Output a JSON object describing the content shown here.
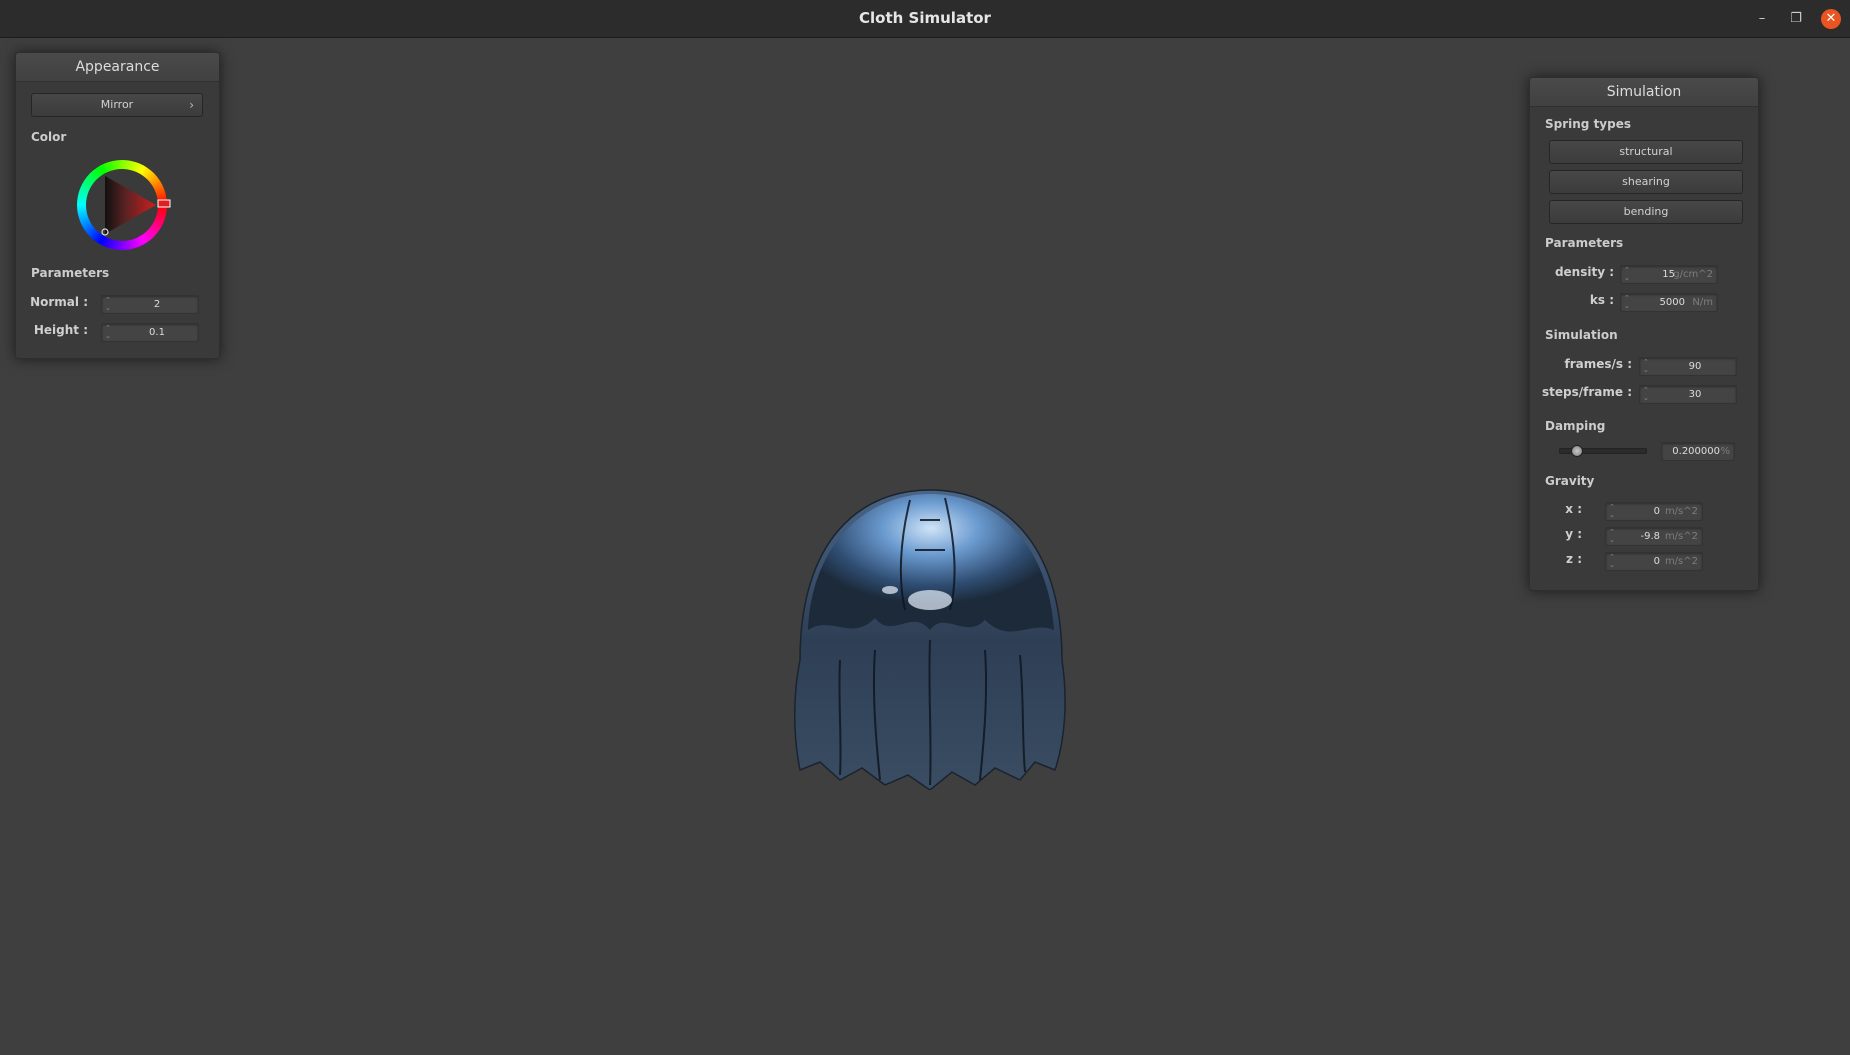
{
  "window": {
    "title": "Cloth Simulator",
    "controls": {
      "minimize": "–",
      "maximize": "❐",
      "close": "✕"
    }
  },
  "appearance": {
    "header": "Appearance",
    "shader_select": "Mirror",
    "shader_chevron": "›",
    "color_label": "Color",
    "color_value": "#cc2222",
    "parameters_label": "Parameters",
    "params": [
      {
        "label": "Normal :",
        "value": "2"
      },
      {
        "label": "Height :",
        "value": "0.1"
      }
    ]
  },
  "simulation": {
    "header": "Simulation",
    "spring_types_label": "Spring types",
    "spring_buttons": [
      "structural",
      "shearing",
      "bending"
    ],
    "parameters_label": "Parameters",
    "density": {
      "label": "density :",
      "value": "15",
      "unit": "g/cm^2"
    },
    "ks": {
      "label": "ks :",
      "value": "5000",
      "unit": "N/m"
    },
    "simulation_label": "Simulation",
    "fps": {
      "label": "frames/s :",
      "value": "90"
    },
    "steps": {
      "label": "steps/frame :",
      "value": "30"
    },
    "damping_label": "Damping",
    "damping": {
      "value": "0.200000",
      "unit": "%",
      "slider_fraction": 0.2
    },
    "gravity_label": "Gravity",
    "gravity": [
      {
        "label": "x :",
        "value": "0",
        "unit": "m/s^2"
      },
      {
        "label": "y :",
        "value": "-9.8",
        "unit": "m/s^2"
      },
      {
        "label": "z :",
        "value": "0",
        "unit": "m/s^2"
      }
    ]
  },
  "colors": {
    "background": "#3f3f3f",
    "panel": "#3a3a3a",
    "close_button": "#e95420"
  }
}
